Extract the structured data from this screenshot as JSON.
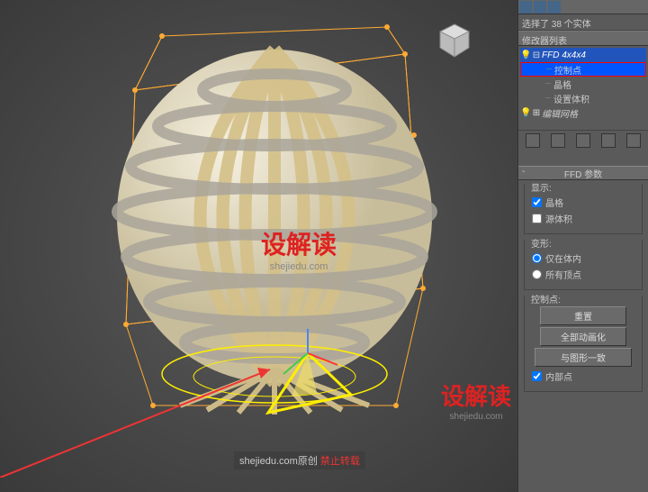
{
  "status": "选择了 38 个实体",
  "modifierListLabel": "修改器列表",
  "modifiers": {
    "ffd": "FFD 4x4x4",
    "ctrlPoints": "控制点",
    "lattice": "晶格",
    "setVolume": "设置体积",
    "editMesh": "编辑网格"
  },
  "rollout": {
    "title": "FFD 参数",
    "display": "显示:",
    "latticeChk": "晶格",
    "sourceVolChk": "源体积",
    "deform": "变形:",
    "inVolume": "仅在体内",
    "allVerts": "所有顶点",
    "controlPts": "控制点:",
    "resetBtn": "重置",
    "animateAllBtn": "全部动画化",
    "matchShapeBtn": "与图形一致",
    "insidePts": "内部点"
  },
  "watermark": {
    "main": "设解读",
    "sub": "shejiedu.com",
    "footer": "shejiedu.com原创",
    "footerRed": "禁止转载"
  }
}
